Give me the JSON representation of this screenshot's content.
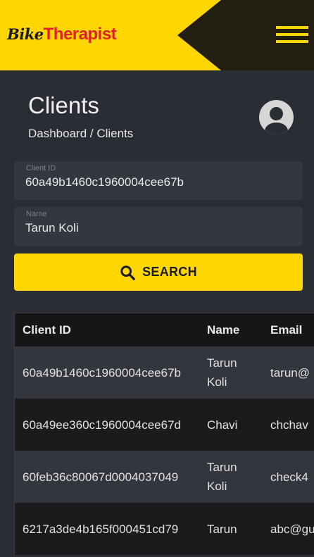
{
  "header": {
    "logo_part1": "Bike",
    "logo_part2": "Therapist",
    "menu_icon": "hamburger-menu-icon",
    "brand_color": "#ffd600"
  },
  "page": {
    "title": "Clients",
    "breadcrumb": "Dashboard / Clients",
    "avatar_icon": "user-circle-icon"
  },
  "form": {
    "client_id_label": "Client ID",
    "client_id_value": "60a49b1460c1960004cee67b",
    "name_label": "Name",
    "name_value": "Tarun Koli",
    "search_label": "SEARCH",
    "search_icon": "search-icon"
  },
  "table": {
    "headers": [
      "Client ID",
      "Name",
      "Email"
    ],
    "rows": [
      {
        "id": "60a49b1460c1960004cee67b",
        "name": "Tarun Koli",
        "email": "tarun@"
      },
      {
        "id": "60a49ee360c1960004cee67d",
        "name": "Chavi",
        "email": "chchav"
      },
      {
        "id": "60feb36c80067d0004037049",
        "name": "Tarun Koli",
        "email": "check4"
      },
      {
        "id": "6217a3de4b165f000451cd79",
        "name": "Tarun",
        "email": "abc@gu"
      }
    ]
  }
}
